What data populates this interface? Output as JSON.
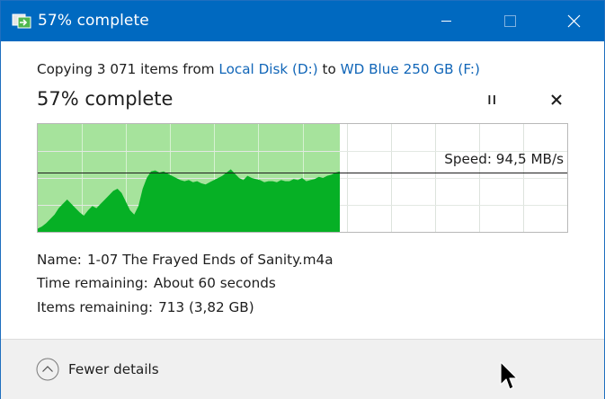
{
  "window": {
    "title": "57% complete",
    "icon": "file-copy-icon",
    "controls": [
      "minimize-icon",
      "maximize-icon",
      "close-icon"
    ]
  },
  "status": {
    "copying_prefix": "Copying 3 071 items from",
    "source": "Local Disk (D:)",
    "to_word": "to",
    "destination": "WD Blue 250 GB (F:)",
    "heading": "57% complete",
    "progress_percent": 57
  },
  "actions": {
    "pause_icon": "pause-icon",
    "cancel_icon": "close-icon"
  },
  "graph": {
    "speed_label": "Speed: 94,5 MB/s",
    "fill_color": "#06b025",
    "remaining_fill_color": "#a6e39c",
    "speed_line_color": "#1e1e1e",
    "speed_line_level": 0.55,
    "speed_profile": [
      0.03,
      0.05,
      0.08,
      0.12,
      0.16,
      0.22,
      0.26,
      0.3,
      0.26,
      0.22,
      0.18,
      0.15,
      0.2,
      0.24,
      0.22,
      0.26,
      0.3,
      0.34,
      0.38,
      0.4,
      0.36,
      0.28,
      0.2,
      0.16,
      0.24,
      0.4,
      0.5,
      0.56,
      0.57,
      0.55,
      0.56,
      0.54,
      0.52,
      0.5,
      0.48,
      0.47,
      0.48,
      0.46,
      0.47,
      0.45,
      0.44,
      0.46,
      0.48,
      0.5,
      0.52,
      0.55,
      0.58,
      0.54,
      0.5,
      0.48,
      0.52,
      0.5,
      0.49,
      0.48,
      0.46,
      0.47,
      0.47,
      0.46,
      0.48,
      0.47,
      0.47,
      0.49,
      0.48,
      0.5,
      0.47,
      0.48,
      0.49,
      0.51,
      0.5,
      0.52,
      0.53,
      0.55,
      0.56
    ]
  },
  "details": {
    "name_label": "Name:",
    "name_value": "1-07 The Frayed Ends of Sanity.m4a",
    "time_label": "Time remaining:",
    "time_value": "About 60 seconds",
    "items_label": "Items remaining:",
    "items_value": "713 (3,82 GB)"
  },
  "footer": {
    "toggle_label": "Fewer details",
    "toggle_icon": "chevron-up-icon"
  }
}
